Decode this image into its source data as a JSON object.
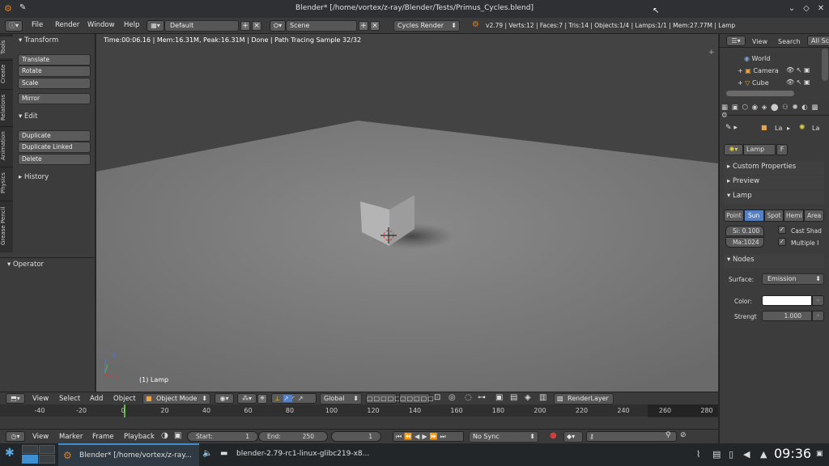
{
  "window": {
    "title": "Blender* [/home/vortex/z-ray/Blender/Tests/Primus_Cycles.blend]"
  },
  "menu": {
    "items": [
      "File",
      "Render",
      "Window",
      "Help"
    ],
    "layout": "Default",
    "scene": "Scene",
    "engine": "Cycles Render",
    "stats": "v2.79 | Verts:12 | Faces:7 | Tris:14 | Objects:1/4 | Lamps:1/1 | Mem:27.77M | Lamp"
  },
  "tool_tabs": [
    "Tools",
    "Create",
    "Relations",
    "Animation",
    "Physics",
    "Grease Pencil"
  ],
  "tools": {
    "transform_header": "Transform",
    "translate": "Translate",
    "rotate": "Rotate",
    "scale": "Scale",
    "mirror": "Mirror",
    "edit_header": "Edit",
    "duplicate": "Duplicate",
    "duplicate_linked": "Duplicate Linked",
    "delete": "Delete",
    "history_header": "History",
    "operator_header": "Operator"
  },
  "viewport": {
    "status": "Time:00:06.16 | Mem:16.31M, Peak:16.31M | Done | Path Tracing Sample 32/32",
    "object_label": "(1) Lamp",
    "axis_x": "x",
    "axis_y": "y",
    "axis_z": "z"
  },
  "view3d_header": {
    "view": "View",
    "select": "Select",
    "add": "Add",
    "object": "Object",
    "mode": "Object Mode",
    "orientation": "Global",
    "render_layer": "RenderLayer"
  },
  "timeline": {
    "ticks": [
      "-40",
      "-20",
      "0",
      "20",
      "40",
      "60",
      "80",
      "100",
      "120",
      "140",
      "160",
      "180",
      "200",
      "220",
      "240",
      "260",
      "280"
    ],
    "view": "View",
    "marker": "Marker",
    "frame": "Frame",
    "playback": "Playback",
    "start_label": "Start:",
    "start_value": "1",
    "end_label": "End:",
    "end_value": "250",
    "current_frame": "1",
    "sync": "No Sync"
  },
  "outliner": {
    "view": "View",
    "search": "Search",
    "all_scenes": "All Sc",
    "items": [
      "World",
      "Camera",
      "Cube"
    ]
  },
  "properties": {
    "crumb1": "La",
    "crumb2": "La",
    "datablock": "Lamp",
    "fake_user": "F",
    "custom_props": "Custom Properties",
    "preview": "Preview",
    "lamp": "Lamp",
    "lamp_types": [
      "Point",
      "Sun",
      "Spot",
      "Hemi",
      "Area"
    ],
    "active_type": "Sun",
    "size_field": "Si: 0.100",
    "max_field": "Ma:1024",
    "cast_shadow": "Cast Shad",
    "multiple_importance": "Multiple I",
    "nodes": "Nodes",
    "surface_label": "Surface:",
    "surface_value": "Emission",
    "color_label": "Color:",
    "color_value": "#ffffff",
    "strength_label": "Strengt",
    "strength_value": "1.000"
  },
  "taskbar": {
    "task1": "Blender* [/home/vortex/z-ray...",
    "task2": "blender-2.79-rc1-linux-glibc219-x8...",
    "clock": "09:36"
  },
  "colors": {
    "accent": "#5680c2",
    "orange": "#e87d0d",
    "panel": "#3c3c3c"
  }
}
